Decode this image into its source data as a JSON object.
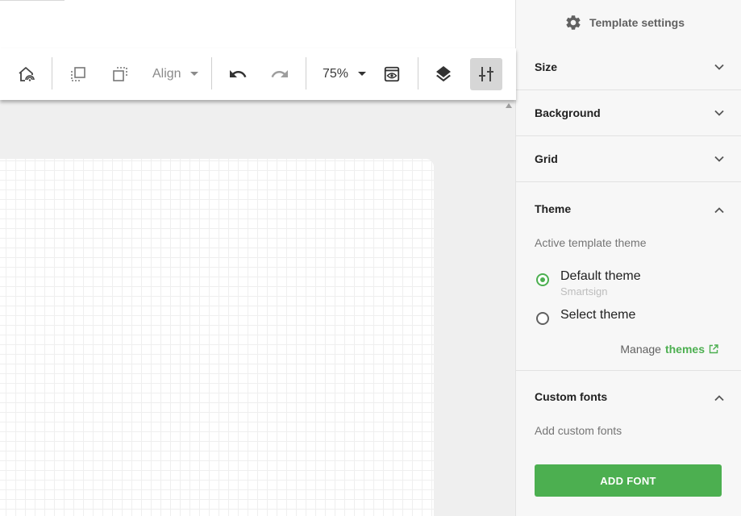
{
  "toolbar": {
    "align_label": "Align",
    "zoom_value": "75%"
  },
  "panel": {
    "title": "Template settings",
    "sections": {
      "size": "Size",
      "background": "Background",
      "grid": "Grid",
      "theme": "Theme",
      "custom_fonts": "Custom fonts"
    },
    "theme": {
      "active_label": "Active template theme",
      "default_theme": "Default theme",
      "default_theme_source": "Smartsign",
      "select_theme": "Select theme",
      "manage_prefix": "Manage",
      "manage_link": "themes"
    },
    "custom_fonts": {
      "add_label": "Add custom fonts",
      "add_button": "ADD FONT"
    }
  },
  "colors": {
    "accent": "#4caf50",
    "panel_bg": "#f7f7f7",
    "canvas_bg": "#efefef"
  },
  "icons": {
    "toolbar": [
      "cast-icon",
      "bring-forward-icon",
      "send-backward-icon",
      "undo-icon",
      "redo-icon",
      "preview-icon",
      "layers-icon",
      "settings-sliders-icon"
    ],
    "panel": [
      "gear-icon",
      "chevron-down-icon",
      "chevron-up-icon",
      "open-in-new-icon"
    ]
  }
}
